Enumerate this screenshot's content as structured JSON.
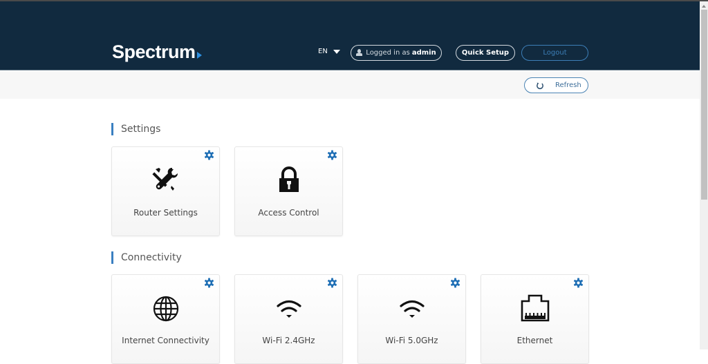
{
  "header": {
    "brand": "Spectrum",
    "language": "EN",
    "logged_in_prefix": "Logged in as",
    "logged_in_user": "admin",
    "quick_setup": "Quick Setup",
    "logout": "Logout"
  },
  "toolbar": {
    "refresh": "Refresh"
  },
  "sections": [
    {
      "title": "Settings",
      "cards": [
        {
          "label": "Router Settings",
          "icon": "tools-icon"
        },
        {
          "label": "Access Control",
          "icon": "lock-icon"
        }
      ]
    },
    {
      "title": "Connectivity",
      "cards": [
        {
          "label": "Internet Connectivity",
          "icon": "globe-icon"
        },
        {
          "label": "Wi-Fi 2.4GHz",
          "icon": "wifi-icon"
        },
        {
          "label": "Wi-Fi 5.0GHz",
          "icon": "wifi-icon"
        },
        {
          "label": "Ethernet",
          "icon": "ethernet-icon"
        }
      ]
    }
  ],
  "colors": {
    "header_bg": "#112a3f",
    "accent": "#3a7fc1",
    "gear": "#1f6fb5"
  }
}
